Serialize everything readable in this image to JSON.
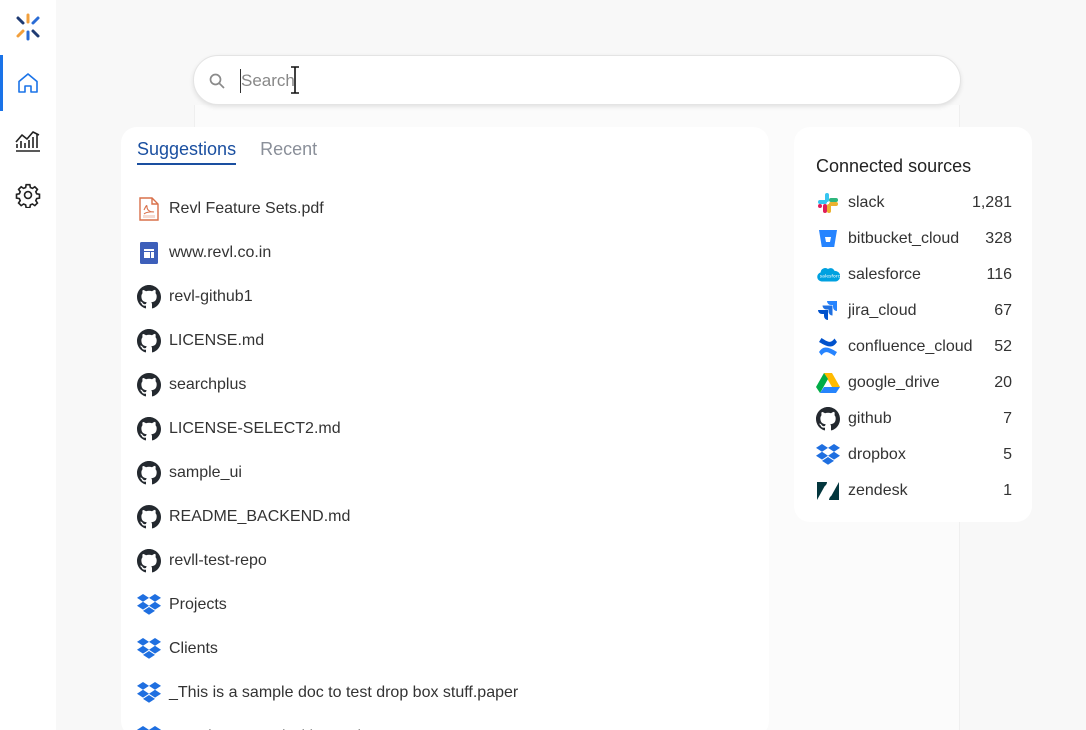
{
  "search": {
    "placeholder": "Search",
    "value": ""
  },
  "sidebar": {
    "items": [
      {
        "name": "home",
        "icon": "home-icon",
        "active": true
      },
      {
        "name": "analytics",
        "icon": "chart-icon",
        "active": false
      },
      {
        "name": "settings",
        "icon": "gear-icon",
        "active": false
      }
    ]
  },
  "tabs": [
    {
      "label": "Suggestions",
      "active": true
    },
    {
      "label": "Recent",
      "active": false
    }
  ],
  "suggestions": [
    {
      "label": "Revl Feature Sets.pdf",
      "icon": "pdf-icon"
    },
    {
      "label": "www.revl.co.in",
      "icon": "doc-icon"
    },
    {
      "label": "revl-github1",
      "icon": "github-icon"
    },
    {
      "label": "LICENSE.md",
      "icon": "github-icon"
    },
    {
      "label": "searchplus",
      "icon": "github-icon"
    },
    {
      "label": "LICENSE-SELECT2.md",
      "icon": "github-icon"
    },
    {
      "label": "sample_ui",
      "icon": "github-icon"
    },
    {
      "label": "README_BACKEND.md",
      "icon": "github-icon"
    },
    {
      "label": "revll-test-repo",
      "icon": "github-icon"
    },
    {
      "label": "Projects",
      "icon": "dropbox-icon"
    },
    {
      "label": "Clients",
      "icon": "dropbox-icon"
    },
    {
      "label": "_This is a sample doc to test drop box stuff.paper",
      "icon": "dropbox-icon"
    },
    {
      "label": "_Getting Started with Dropbox Paper.paper",
      "icon": "dropbox-icon"
    }
  ],
  "sources": {
    "title": "Connected sources",
    "items": [
      {
        "name": "slack",
        "count": "1,281",
        "icon": "slack-icon"
      },
      {
        "name": "bitbucket_cloud",
        "count": "328",
        "icon": "bitbucket-icon"
      },
      {
        "name": "salesforce",
        "count": "116",
        "icon": "salesforce-icon"
      },
      {
        "name": "jira_cloud",
        "count": "67",
        "icon": "jira-icon"
      },
      {
        "name": "confluence_cloud",
        "count": "52",
        "icon": "confluence-icon"
      },
      {
        "name": "google_drive",
        "count": "20",
        "icon": "google-drive-icon"
      },
      {
        "name": "github",
        "count": "7",
        "icon": "github-icon"
      },
      {
        "name": "dropbox",
        "count": "5",
        "icon": "dropbox-icon"
      },
      {
        "name": "zendesk",
        "count": "1",
        "icon": "zendesk-icon"
      }
    ]
  },
  "colors": {
    "accent": "#1a4fa0",
    "nav_active": "#1a73e8",
    "dropbox": "#1f6fe0",
    "github": "#24292f"
  }
}
